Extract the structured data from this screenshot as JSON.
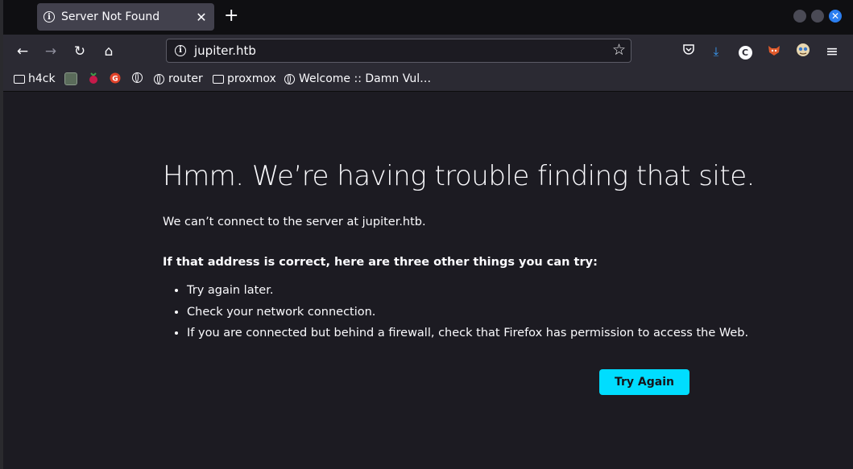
{
  "tab": {
    "title": "Server Not Found",
    "close_glyph": "✕",
    "newtab_glyph": "+"
  },
  "nav": {
    "url": "jupiter.htb",
    "back_glyph": "←",
    "forward_glyph": "→",
    "reload_glyph": "↻",
    "home_glyph": "⌂",
    "star_glyph": "☆"
  },
  "toolbar": {
    "download_glyph": "⤓",
    "menu_glyph": "≡",
    "c_glyph": "C"
  },
  "bookmarks": [
    {
      "label": "h4ck",
      "icon": "folder-icon"
    },
    {
      "label": "",
      "icon": "site-icon"
    },
    {
      "label": "",
      "icon": "raspberry-icon"
    },
    {
      "label": "",
      "icon": "gitlab-icon"
    },
    {
      "label": "",
      "icon": "globe-icon"
    },
    {
      "label": "router",
      "icon": "globe-icon"
    },
    {
      "label": "proxmox",
      "icon": "folder-icon"
    },
    {
      "label": "Welcome :: Damn Vul…",
      "icon": "globe-icon"
    }
  ],
  "error": {
    "title": "Hmm. We’re having trouble finding that site.",
    "description": "We can’t connect to the server at jupiter.htb.",
    "suggestions_heading": "If that address is correct, here are three other things you can try:",
    "suggestions": [
      "Try again later.",
      "Check your network connection.",
      "If you are connected but behind a firewall, check that Firefox has permission to access the Web."
    ],
    "button_label": "Try Again"
  },
  "colors": {
    "accent": "#00ddff",
    "page_bg": "#1c1b22",
    "chrome_bg": "#2b2a33",
    "tab_bg": "#42414d"
  }
}
